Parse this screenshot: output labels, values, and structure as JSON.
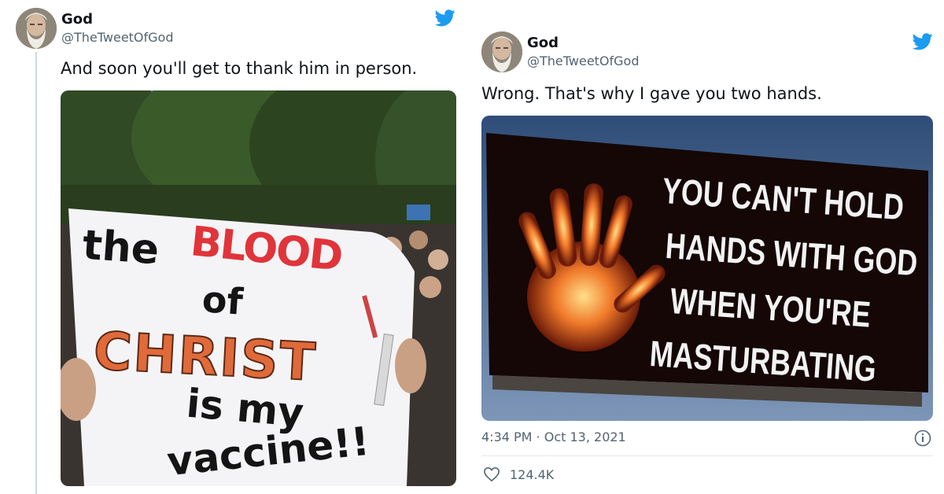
{
  "left_tweet": {
    "author_name": "God",
    "author_handle": "@TheTweetOfGod",
    "text": "And soon you'll get to thank him in person.",
    "sign": {
      "line1_a": "the",
      "line1_b": "BLOOD",
      "line2": "of",
      "line3": "CHRIST",
      "line4": "is my",
      "line5": "vaccine!!"
    }
  },
  "right_tweet": {
    "author_name": "God",
    "author_handle": "@TheTweetOfGod",
    "text": "Wrong. That's why I gave you two hands.",
    "billboard": {
      "line1": "YOU CAN'T HOLD",
      "line2": "HANDS WITH GOD",
      "line3": "WHEN YOU'RE",
      "line4": "MASTURBATING"
    },
    "timestamp": "4:34 PM · Oct 13, 2021",
    "likes": "124.4K"
  },
  "colors": {
    "twitter_blue": "#1d9bf0",
    "text_primary": "#0f1419",
    "text_secondary": "#536471",
    "sign_red": "#e0343a",
    "sign_orange": "#e06a3a"
  },
  "icons": {
    "brand": "twitter-bird-icon",
    "info": "info-icon",
    "like": "heart-icon"
  }
}
